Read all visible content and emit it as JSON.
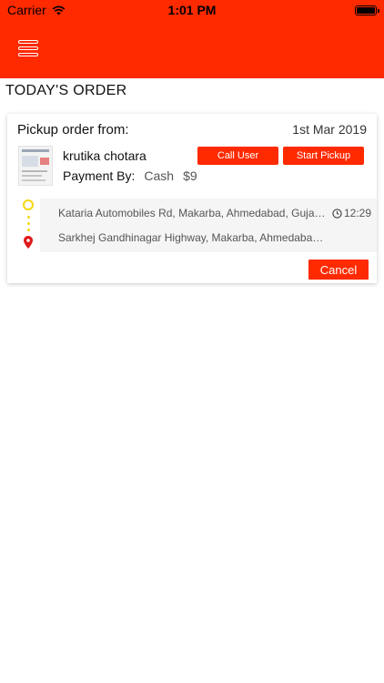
{
  "status_bar": {
    "carrier": "Carrier",
    "time": "1:01 PM",
    "wifi_icon": "wifi-icon",
    "battery_icon": "battery-icon"
  },
  "nav": {
    "menu_icon": "hamburger-menu-icon",
    "accent_color": "#ff2a00"
  },
  "section": {
    "title": "TODAY'S ORDER"
  },
  "order": {
    "label": "Pickup order from:",
    "date": "1st Mar 2019",
    "customer_name": "krutika chotara",
    "payment_label": "Payment By:",
    "payment_method": "Cash",
    "payment_amount": "$9",
    "call_button": "Call User",
    "pickup_button": "Start Pickup",
    "pickup_address": "Kataria Automobiles Rd, Makarba, Ahmedabad, Gujarat",
    "drop_address": "Sarkhej Gandhinagar Highway, Makarba, Ahmedabad, Gujarat",
    "eta": "12:29",
    "cancel_button": "Cancel"
  }
}
